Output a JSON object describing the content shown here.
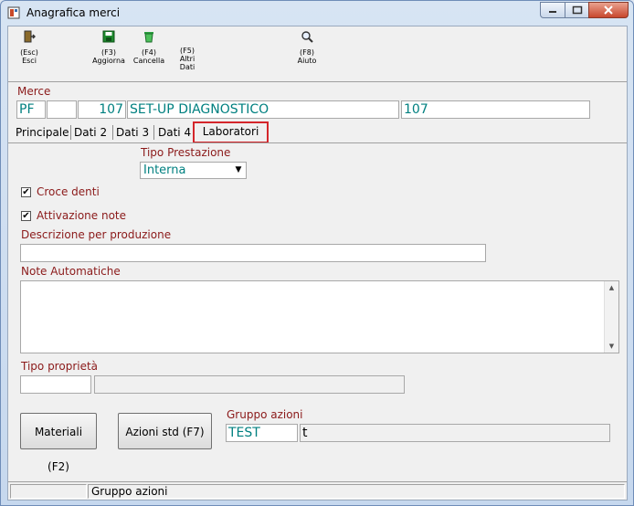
{
  "window": {
    "title": "Anagrafica merci"
  },
  "toolbar": {
    "esc": {
      "key": "(Esc)",
      "label": "Esci"
    },
    "f3": {
      "key": "(F3)",
      "label": "Aggiorna"
    },
    "f4": {
      "key": "(F4)",
      "label": "Cancella"
    },
    "f5": {
      "key": "(F5)",
      "label": "Altri",
      "label2": "Dati"
    },
    "f8": {
      "key": "(F8)",
      "label": "Aiuto"
    }
  },
  "merce": {
    "label": "Merce",
    "type": "PF",
    "sub": "",
    "code": "107",
    "description": "SET-UP DIAGNOSTICO",
    "code2": "107"
  },
  "tabs": {
    "principale": "Principale",
    "dati2": "Dati 2",
    "dati3": "Dati 3",
    "dati4": "Dati 4",
    "laboratori": "Laboratori"
  },
  "form": {
    "tipo_prestazione_label": "Tipo Prestazione",
    "tipo_prestazione_value": "Interna",
    "croce_denti_label": "Croce denti",
    "croce_denti_checked": true,
    "attivazione_note_label": "Attivazione note",
    "attivazione_note_checked": true,
    "descrizione_label": "Descrizione per produzione",
    "descrizione_value": "",
    "note_label": "Note Automatiche",
    "note_value": "",
    "tipo_proprieta_label": "Tipo proprietà",
    "tipo_proprieta_code": "",
    "tipo_proprieta_desc": "",
    "gruppo_azioni_label": "Gruppo azioni",
    "gruppo_azioni_code": "TEST",
    "gruppo_azioni_desc": "t"
  },
  "buttons": {
    "materiali": "Materiali (F2)",
    "azioni_std": "Azioni std (F7)"
  },
  "status": {
    "cell1": "",
    "cell2": "Gruppo azioni"
  },
  "colors": {
    "label": "#8b1a1a",
    "value": "#008080",
    "highlight": "#d4262b"
  }
}
